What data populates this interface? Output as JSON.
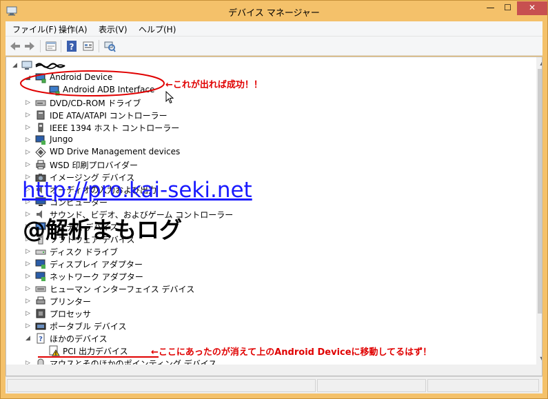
{
  "window": {
    "title": "デバイス マネージャー",
    "min_glyph": "—",
    "max_glyph": "☐",
    "close_glyph": "✕"
  },
  "menu": [
    "ファイル(F)",
    "操作(A)",
    "表示(V)",
    "ヘルプ(H)"
  ],
  "toolbar": [
    "back-icon",
    "forward-icon",
    "properties-icon",
    "help-icon",
    "show-hidden-icon",
    "scan-hardware-icon"
  ],
  "tree": {
    "root_label": "computer-name",
    "nodes": [
      {
        "label": "Android Device",
        "expanded": true,
        "icon": "android-device-icon"
      },
      {
        "label": "Android ADB Interface",
        "child": true,
        "icon": "adb-interface-icon"
      },
      {
        "label": "DVD/CD-ROM ドライブ",
        "icon": "dvd-icon"
      },
      {
        "label": "IDE ATA/ATAPI コントローラー",
        "icon": "ide-controller-icon"
      },
      {
        "label": "IEEE 1394 ホスト コントローラー",
        "icon": "ieee1394-icon"
      },
      {
        "label": "Jungo",
        "icon": "jungo-icon"
      },
      {
        "label": "WD Drive Management devices",
        "icon": "wd-icon"
      },
      {
        "label": "WSD 印刷プロバイダー",
        "icon": "printer-provider-icon"
      },
      {
        "label": "イメージング デバイス",
        "icon": "imaging-icon"
      },
      {
        "label": "オーディオの入力および出力",
        "icon": "audio-icon"
      },
      {
        "label": "コンピューター",
        "icon": "computer-icon"
      },
      {
        "label": "サウンド、ビデオ、およびゲーム コントローラー",
        "icon": "sound-icon"
      },
      {
        "label": "システム デバイス",
        "icon": "system-icon"
      },
      {
        "label": "ソフトウェア デバイス",
        "icon": "software-icon"
      },
      {
        "label": "ディスク ドライブ",
        "icon": "disk-icon"
      },
      {
        "label": "ディスプレイ アダプター",
        "icon": "display-icon"
      },
      {
        "label": "ネットワーク アダプター",
        "icon": "network-icon"
      },
      {
        "label": "ヒューマン インターフェイス デバイス",
        "icon": "hid-icon"
      },
      {
        "label": "プリンター",
        "icon": "printer-icon"
      },
      {
        "label": "プロセッサ",
        "icon": "processor-icon"
      },
      {
        "label": "ポータブル デバイス",
        "icon": "portable-icon"
      },
      {
        "label": "ほかのデバイス",
        "expanded": true,
        "icon": "other-device-icon"
      },
      {
        "label": "PCI 出力デバイス",
        "child": true,
        "icon": "warning-device-icon"
      },
      {
        "label": "マウスとそのほかのポインティング デバイス",
        "icon": "mouse-icon"
      }
    ]
  },
  "annotations": {
    "success_note": "←これが出れば成功！！",
    "moved_note": "←ここにあったのが消えて上のAndroid Deviceに移動してるはず！",
    "url": "http://pro.kai-seki.net",
    "blog": "@解析まもログ"
  },
  "colors": {
    "titlebar": "#f4c16a",
    "close": "#c75050",
    "annotation_red": "#e00000",
    "url_blue": "#1a1aff"
  }
}
